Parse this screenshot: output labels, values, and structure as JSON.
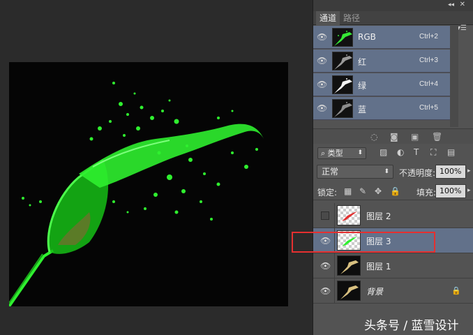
{
  "channels_panel": {
    "collapse_icon": "double-chevron-left-icon",
    "close_icon": "close-icon",
    "tabs": [
      {
        "label": "通道",
        "active": true
      },
      {
        "label": "路径",
        "active": false
      }
    ],
    "menu_icon": "panel-menu-icon",
    "channels": [
      {
        "name": "RGB",
        "shortcut": "Ctrl+2",
        "thumb_color": "#36e836"
      },
      {
        "name": "红",
        "shortcut": "Ctrl+3",
        "thumb_color": "#9a9a9a"
      },
      {
        "name": "绿",
        "shortcut": "Ctrl+4",
        "thumb_color": "#f2f2f2"
      },
      {
        "name": "蓝",
        "shortcut": "Ctrl+5",
        "thumb_color": "#8c8c8c"
      }
    ],
    "bottom_icons": [
      "load-selection-icon",
      "save-selection-icon",
      "new-channel-icon",
      "delete-channel-icon"
    ]
  },
  "layers_panel": {
    "filter_label": "类型",
    "filter_icons": [
      "image-filter-icon",
      "adjustment-filter-icon",
      "type-filter-icon",
      "shape-filter-icon",
      "smart-object-filter-icon"
    ],
    "blend_mode": "正常",
    "opacity_label": "不透明度:",
    "opacity_value": "100%",
    "lock_label": "锁定:",
    "lock_icons": [
      "lock-transparent-icon",
      "lock-image-icon",
      "lock-position-icon",
      "lock-all-icon"
    ],
    "fill_label": "填充:",
    "fill_value": "100%",
    "layers": [
      {
        "name": "图层 2",
        "visible": false,
        "selected": false,
        "thumb": "checker-red"
      },
      {
        "name": "图层 3",
        "visible": true,
        "selected": true,
        "thumb": "checker-green"
      },
      {
        "name": "图层 1",
        "visible": true,
        "selected": false,
        "thumb": "dark-gold"
      },
      {
        "name": "背景",
        "visible": true,
        "selected": false,
        "thumb": "dark-gold",
        "locked": true
      }
    ]
  },
  "canvas": {
    "background": "#050505",
    "splash_color": "#2ff02f"
  },
  "colors": {
    "selected_row": "#62718a",
    "panel_bg": "#535353",
    "highlight_box": "#e53030"
  },
  "watermark": "头条号 / 蓝雪设计"
}
